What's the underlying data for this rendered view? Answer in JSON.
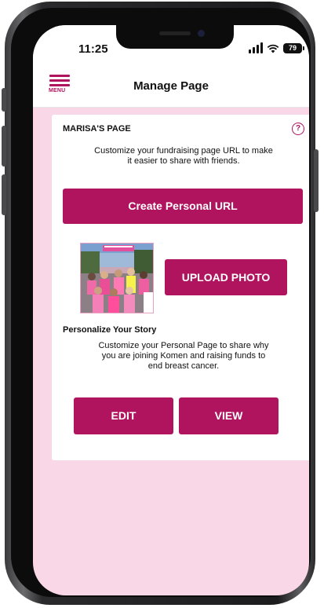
{
  "status_bar": {
    "time": "11:25",
    "battery": "79"
  },
  "header": {
    "menu_label": "MENU",
    "title": "Manage Page"
  },
  "card": {
    "title": "MARISA'S PAGE",
    "help_glyph": "?",
    "url_description_line1": "Customize your fundraising page URL to make",
    "url_description_line2": "it easier to share with friends.",
    "create_url_label": "Create Personal URL",
    "upload_photo_label": "UPLOAD PHOTO",
    "story_title": "Personalize Your Story",
    "story_description_line1": "Customize your Personal Page to share why",
    "story_description_line2": "you are joining Komen and raising funds to",
    "story_description_line3": "end breast cancer.",
    "edit_label": "EDIT",
    "view_label": "VIEW"
  },
  "icons": {
    "menu": "hamburger-menu-icon",
    "help": "question-circle-icon",
    "signal": "cellular-signal-icon",
    "wifi": "wifi-icon",
    "battery": "battery-icon"
  },
  "colors": {
    "accent": "#b0145f",
    "page_background": "#fad7e6",
    "card_background": "#ffffff"
  }
}
